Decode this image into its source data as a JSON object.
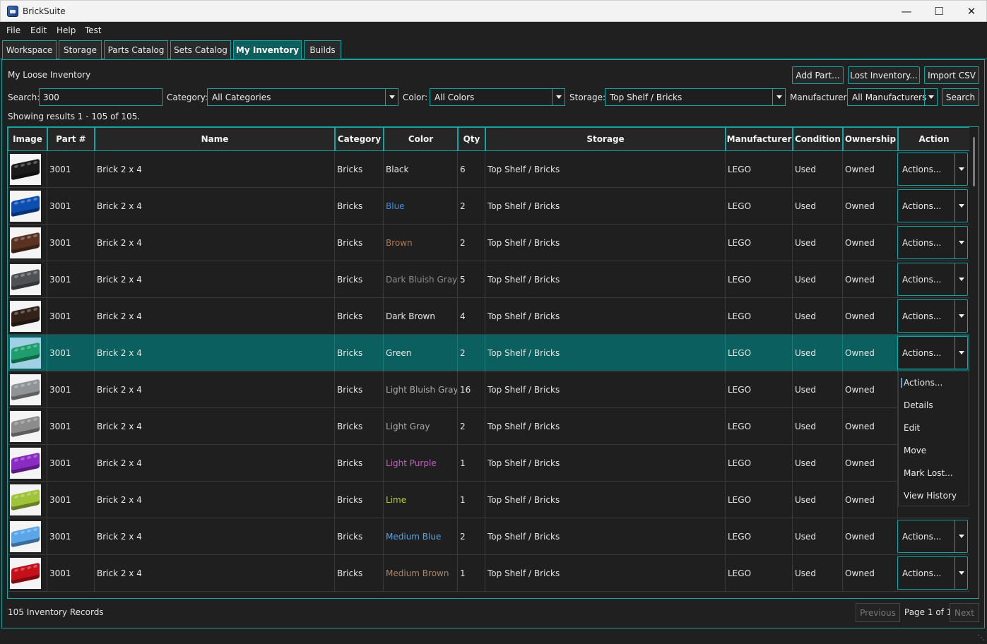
{
  "window": {
    "title": "BrickSuite"
  },
  "menu": [
    "File",
    "Edit",
    "Help",
    "Test"
  ],
  "tabs": [
    "Workspace",
    "Storage",
    "Parts Catalog",
    "Sets Catalog",
    "My Inventory",
    "Builds"
  ],
  "active_tab": "My Inventory",
  "panel": {
    "title": "My Loose Inventory",
    "buttons": {
      "add_part": "Add Part...",
      "lost_inventory": "Lost Inventory...",
      "import_csv": "Import CSV"
    }
  },
  "filters": {
    "search_label": "Search:",
    "search_value": "300",
    "category_label": "Category:",
    "category_value": "All Categories",
    "color_label": "Color:",
    "color_value": "All Colors",
    "storage_label": "Storage:",
    "storage_value": "Top Shelf / Bricks",
    "manufacturer_label": "Manufacturer:",
    "manufacturer_value": "All Manufacturers",
    "search_button": "Search"
  },
  "results_text": "Showing results 1 - 105 of 105.",
  "table": {
    "columns": [
      "Image",
      "Part #",
      "Name",
      "Category",
      "Color",
      "Qty",
      "Storage",
      "Manufacturer",
      "Condition",
      "Ownership",
      "Action"
    ],
    "rows": [
      {
        "part": "3001",
        "name": "Brick 2 x 4",
        "category": "Bricks",
        "color": "Black",
        "color_hex": "#e6e6e6",
        "brick_hex": "#1b1b1b",
        "qty": "6",
        "storage": "Top Shelf / Bricks",
        "manufacturer": "LEGO",
        "condition": "Used",
        "ownership": "Owned",
        "action": "Actions..."
      },
      {
        "part": "3001",
        "name": "Brick 2 x 4",
        "category": "Bricks",
        "color": "Blue",
        "color_hex": "#3b8ee8",
        "brick_hex": "#0d4fb0",
        "qty": "2",
        "storage": "Top Shelf / Bricks",
        "manufacturer": "LEGO",
        "condition": "Used",
        "ownership": "Owned",
        "action": "Actions..."
      },
      {
        "part": "3001",
        "name": "Brick 2 x 4",
        "category": "Bricks",
        "color": "Brown",
        "color_hex": "#b07a52",
        "brick_hex": "#5a3222",
        "qty": "2",
        "storage": "Top Shelf / Bricks",
        "manufacturer": "LEGO",
        "condition": "Used",
        "ownership": "Owned",
        "action": "Actions..."
      },
      {
        "part": "3001",
        "name": "Brick 2 x 4",
        "category": "Bricks",
        "color": "Dark Bluish Gray",
        "color_hex": "#8d8d8d",
        "brick_hex": "#4f5254",
        "qty": "5",
        "storage": "Top Shelf / Bricks",
        "manufacturer": "LEGO",
        "condition": "Used",
        "ownership": "Owned",
        "action": "Actions..."
      },
      {
        "part": "3001",
        "name": "Brick 2 x 4",
        "category": "Bricks",
        "color": "Dark Brown",
        "color_hex": "#e6e6e6",
        "brick_hex": "#33221a",
        "qty": "4",
        "storage": "Top Shelf / Bricks",
        "manufacturer": "LEGO",
        "condition": "Used",
        "ownership": "Owned",
        "action": "Actions..."
      },
      {
        "part": "3001",
        "name": "Brick 2 x 4",
        "category": "Bricks",
        "color": "Green",
        "color_hex": "#e6e6e6",
        "brick_hex": "#1e9e6e",
        "qty": "2",
        "storage": "Top Shelf / Bricks",
        "manufacturer": "LEGO",
        "condition": "Used",
        "ownership": "Owned",
        "action": "Actions...",
        "selected": true
      },
      {
        "part": "3001",
        "name": "Brick 2 x 4",
        "category": "Bricks",
        "color": "Light Bluish Gray",
        "color_hex": "#a9a9a9",
        "brick_hex": "#8f9396",
        "qty": "16",
        "storage": "Top Shelf / Bricks",
        "manufacturer": "LEGO",
        "condition": "Used",
        "ownership": "Owned",
        "action": "Actions..."
      },
      {
        "part": "3001",
        "name": "Brick 2 x 4",
        "category": "Bricks",
        "color": "Light Gray",
        "color_hex": "#a9a9a9",
        "brick_hex": "#8c8c8c",
        "qty": "2",
        "storage": "Top Shelf / Bricks",
        "manufacturer": "LEGO",
        "condition": "Used",
        "ownership": "Owned",
        "action": "Actions..."
      },
      {
        "part": "3001",
        "name": "Brick 2 x 4",
        "category": "Bricks",
        "color": "Light Purple",
        "color_hex": "#c45fc0",
        "brick_hex": "#8a2bc2",
        "qty": "1",
        "storage": "Top Shelf / Bricks",
        "manufacturer": "LEGO",
        "condition": "Used",
        "ownership": "Owned",
        "action": "Actions..."
      },
      {
        "part": "3001",
        "name": "Brick 2 x 4",
        "category": "Bricks",
        "color": "Lime",
        "color_hex": "#b5d32a",
        "brick_hex": "#9fc43a",
        "qty": "1",
        "storage": "Top Shelf / Bricks",
        "manufacturer": "LEGO",
        "condition": "Used",
        "ownership": "Owned",
        "action": "Actions..."
      },
      {
        "part": "3001",
        "name": "Brick 2 x 4",
        "category": "Bricks",
        "color": "Medium Blue",
        "color_hex": "#5aa3e2",
        "brick_hex": "#5aa6e8",
        "qty": "2",
        "storage": "Top Shelf / Bricks",
        "manufacturer": "LEGO",
        "condition": "Used",
        "ownership": "Owned",
        "action": "Actions..."
      },
      {
        "part": "3001",
        "name": "Brick 2 x 4",
        "category": "Bricks",
        "color": "Medium Brown",
        "color_hex": "#a8866a",
        "brick_hex": "#c4101a",
        "qty": "1",
        "storage": "Top Shelf / Bricks",
        "manufacturer": "LEGO",
        "condition": "Used",
        "ownership": "Owned",
        "action": "Actions..."
      }
    ]
  },
  "action_menu": {
    "open_on_row": 5,
    "items": [
      "Actions...",
      "Details",
      "Edit",
      "Move",
      "Mark Lost...",
      "View History"
    ]
  },
  "footer": {
    "records_text": "105 Inventory Records",
    "previous": "Previous",
    "page_label": "Page 1 of 1",
    "next": "Next"
  },
  "colors": {
    "accent": "#18a3a3",
    "selected_row": "#0b5f5f",
    "background": "#202020"
  }
}
